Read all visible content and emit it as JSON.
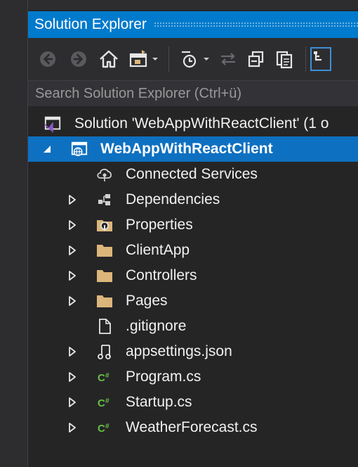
{
  "panel": {
    "title": "Solution Explorer"
  },
  "toolbar": {
    "buttons": [
      {
        "icon": "back-arrow-icon"
      },
      {
        "icon": "forward-arrow-icon"
      },
      {
        "icon": "home-icon"
      },
      {
        "icon": "switch-views-icon"
      },
      {
        "icon": "pending-changes-filter-icon"
      },
      {
        "icon": "sync-with-active-document-icon"
      },
      {
        "icon": "collapse-all-icon"
      },
      {
        "icon": "show-all-files-icon"
      },
      {
        "icon": "properties-icon"
      }
    ]
  },
  "search": {
    "placeholder": "Search Solution Explorer (Ctrl+ü)"
  },
  "tree": {
    "solution": "Solution 'WebAppWithReactClient' (1 o",
    "project": "WebAppWithReactClient",
    "items": [
      {
        "label": "Connected Services",
        "icon": "connected-services-icon"
      },
      {
        "label": "Dependencies",
        "icon": "dependencies-icon"
      },
      {
        "label": "Properties",
        "icon": "properties-folder-icon"
      },
      {
        "label": "ClientApp",
        "icon": "folder-icon"
      },
      {
        "label": "Controllers",
        "icon": "folder-icon"
      },
      {
        "label": "Pages",
        "icon": "folder-icon"
      },
      {
        "label": ".gitignore",
        "icon": "file-icon"
      },
      {
        "label": "appsettings.json",
        "icon": "json-file-icon"
      },
      {
        "label": "Program.cs",
        "icon": "csharp-file-icon"
      },
      {
        "label": "Startup.cs",
        "icon": "csharp-file-icon"
      },
      {
        "label": "WeatherForecast.cs",
        "icon": "csharp-file-icon"
      }
    ]
  },
  "colors": {
    "accent": "#007acc",
    "selection": "#0e70c0",
    "background": "#252526",
    "folder": "#dcb67a",
    "csharp": "#68c046"
  }
}
